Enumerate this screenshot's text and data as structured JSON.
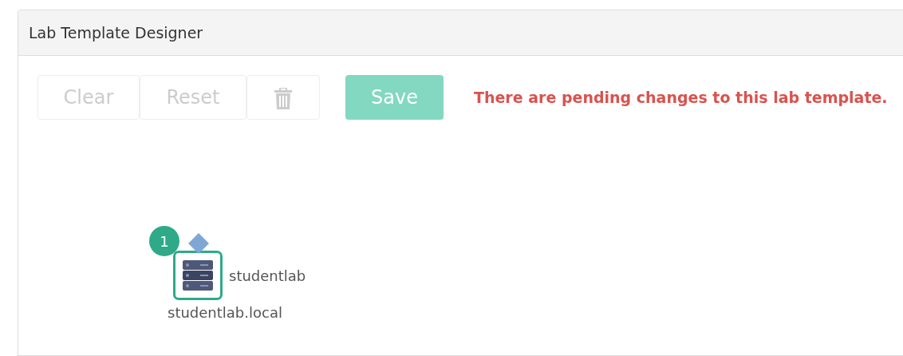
{
  "panel": {
    "title": "Lab Template Designer"
  },
  "toolbar": [
    {
      "kind": "text",
      "label": "Clear",
      "disabled": true
    },
    {
      "kind": "text",
      "label": "Reset",
      "disabled": true
    },
    {
      "kind": "trash",
      "disabled": true
    },
    {
      "kind": "primary",
      "label": "Save",
      "disabled": true
    }
  ],
  "message": "There are pending changes to this lab template.",
  "nodes": [
    {
      "badge": "1",
      "name": "studentlab",
      "hostname": "studentlab.local",
      "selected": true
    }
  ]
}
